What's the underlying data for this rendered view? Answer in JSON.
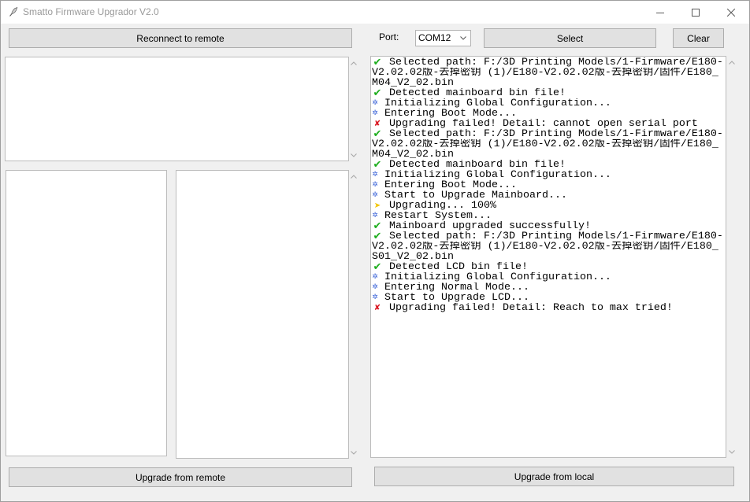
{
  "window": {
    "title": "Smatto Firmware Upgrador V2.0",
    "app_icon": "feather-icon",
    "controls": [
      "minimize-icon",
      "maximize-icon",
      "close-icon"
    ]
  },
  "remote": {
    "reconnect_label": "Reconnect to remote",
    "upgrade_label": "Upgrade from remote"
  },
  "local": {
    "port_label": "Port:",
    "port_value": "COM12",
    "select_label": "Select",
    "clear_label": "Clear",
    "upgrade_label": "Upgrade from local"
  },
  "log": {
    "icon_colors": {
      "check-icon": "#1fae1f",
      "gear-icon": "#3b63d8",
      "cross-icon": "#d9131e",
      "arrow-right-icon": "#f2c500"
    },
    "entries": [
      {
        "icon": "check-icon",
        "lines": [
          "Selected path: F:/3D Printing Models/1-Firmware/E180-",
          "V2.02.02版-去掉密钥 (1)/E180-V2.02.02版-去掉密钥/固件/E180_",
          "M04_V2_02.bin"
        ]
      },
      {
        "icon": "check-icon",
        "lines": [
          "Detected mainboard bin file!"
        ]
      },
      {
        "icon": "gear-icon",
        "lines": [
          "Initializing Global Configuration..."
        ]
      },
      {
        "icon": "gear-icon",
        "lines": [
          "Entering Boot Mode..."
        ]
      },
      {
        "icon": "cross-icon",
        "lines": [
          "Upgrading failed! Detail: cannot open serial port"
        ]
      },
      {
        "icon": "check-icon",
        "lines": [
          "Selected path: F:/3D Printing Models/1-Firmware/E180-",
          "V2.02.02版-去掉密钥 (1)/E180-V2.02.02版-去掉密钥/固件/E180_",
          "M04_V2_02.bin"
        ]
      },
      {
        "icon": "check-icon",
        "lines": [
          "Detected mainboard bin file!"
        ]
      },
      {
        "icon": "gear-icon",
        "lines": [
          "Initializing Global Configuration..."
        ]
      },
      {
        "icon": "gear-icon",
        "lines": [
          "Entering Boot Mode..."
        ]
      },
      {
        "icon": "gear-icon",
        "lines": [
          "Start to Upgrade Mainboard..."
        ]
      },
      {
        "icon": "arrow-right-icon",
        "lines": [
          "Upgrading... 100%"
        ]
      },
      {
        "icon": "gear-icon",
        "lines": [
          "Restart System..."
        ]
      },
      {
        "icon": "check-icon",
        "lines": [
          "Mainboard upgraded successfully!"
        ]
      },
      {
        "icon": "check-icon",
        "lines": [
          "Selected path: F:/3D Printing Models/1-Firmware/E180-",
          "V2.02.02版-去掉密钥 (1)/E180-V2.02.02版-去掉密钥/固件/E180_",
          "S01_V2_02.bin"
        ]
      },
      {
        "icon": "check-icon",
        "lines": [
          "Detected LCD bin file!"
        ]
      },
      {
        "icon": "gear-icon",
        "lines": [
          "Initializing Global Configuration..."
        ]
      },
      {
        "icon": "gear-icon",
        "lines": [
          "Entering Normal Mode..."
        ]
      },
      {
        "icon": "gear-icon",
        "lines": [
          "Start to Upgrade LCD..."
        ]
      },
      {
        "icon": "cross-icon",
        "lines": [
          "Upgrading failed! Detail: Reach to max tried!"
        ]
      }
    ]
  }
}
